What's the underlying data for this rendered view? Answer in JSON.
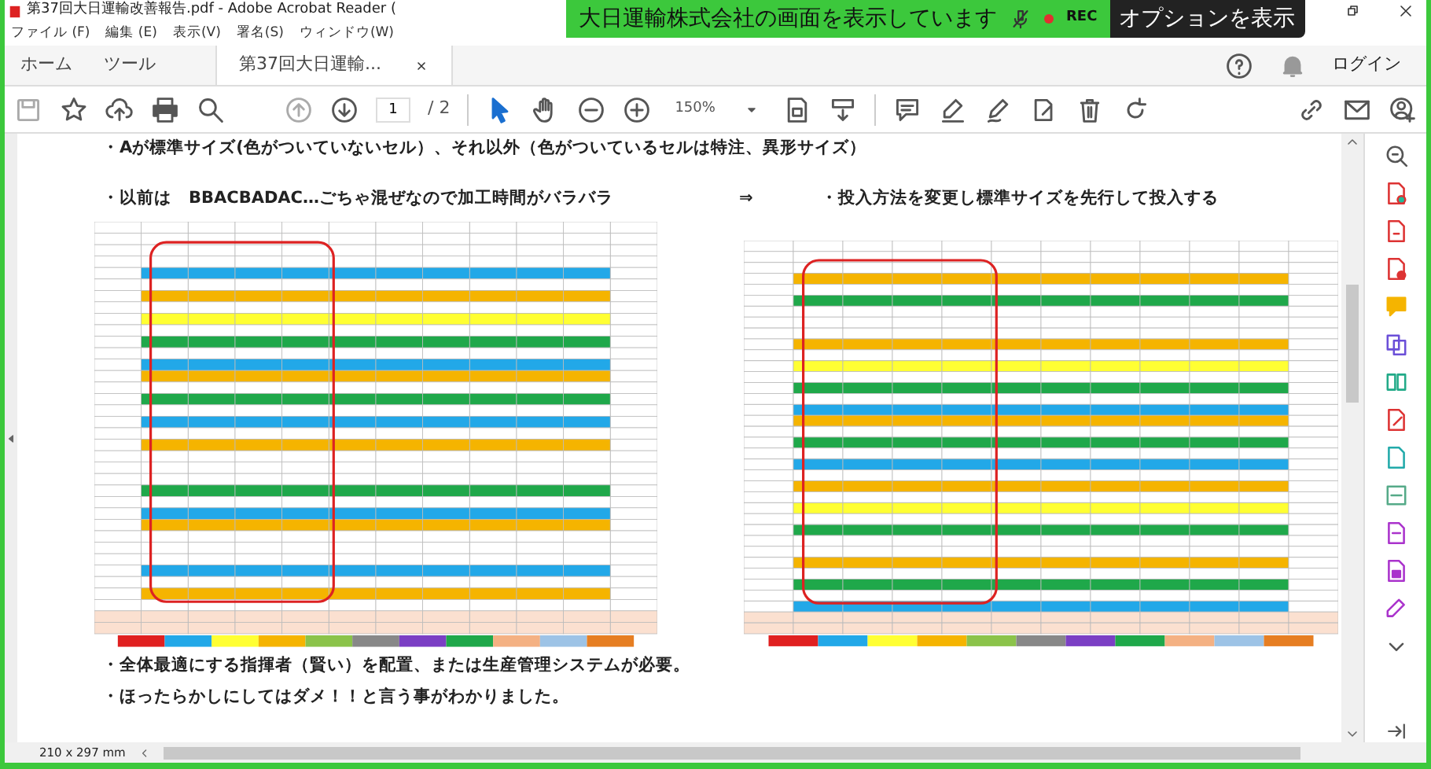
{
  "window": {
    "title": "第37回大日運輸改善報告.pdf - Adobe Acrobat Reader ("
  },
  "share_banner": {
    "message": "大日運輸株式会社の画面を表示しています",
    "rec": "REC",
    "options": "オプションを表示"
  },
  "menu": [
    "ファイル (F)",
    "編集 (E)",
    "表示(V)",
    "署名(S)",
    "ウィンドウ(W)"
  ],
  "nav_tabs": [
    {
      "label": "ホーム",
      "selected": false
    },
    {
      "label": "ツール",
      "selected": false
    },
    {
      "label": "第37回大日運輸...",
      "selected": true
    }
  ],
  "login": "ログイン",
  "toolbar": {
    "page": "1",
    "page_total": "/ 2",
    "zoom": "150%"
  },
  "document": {
    "note": "・Aが標準サイズ(色がついていないセル）、それ以外（色がついているセルは特注、異形サイズ）",
    "before": "・以前は　BBACBADAC…ごちゃ混ぜなので加工時間がバラバラ",
    "arrow": "⇒",
    "after": "・投入方法を変更し標準サイズを先行して投入する",
    "conclusions": [
      "・全体最適にする指揮者（賢い）を配置、または生産管理システムが必要。",
      "・ほったらかしにしてはダメ！！と言う事がわかりました。"
    ]
  },
  "status_bar": {
    "page_size": "210 x 297 mm"
  }
}
